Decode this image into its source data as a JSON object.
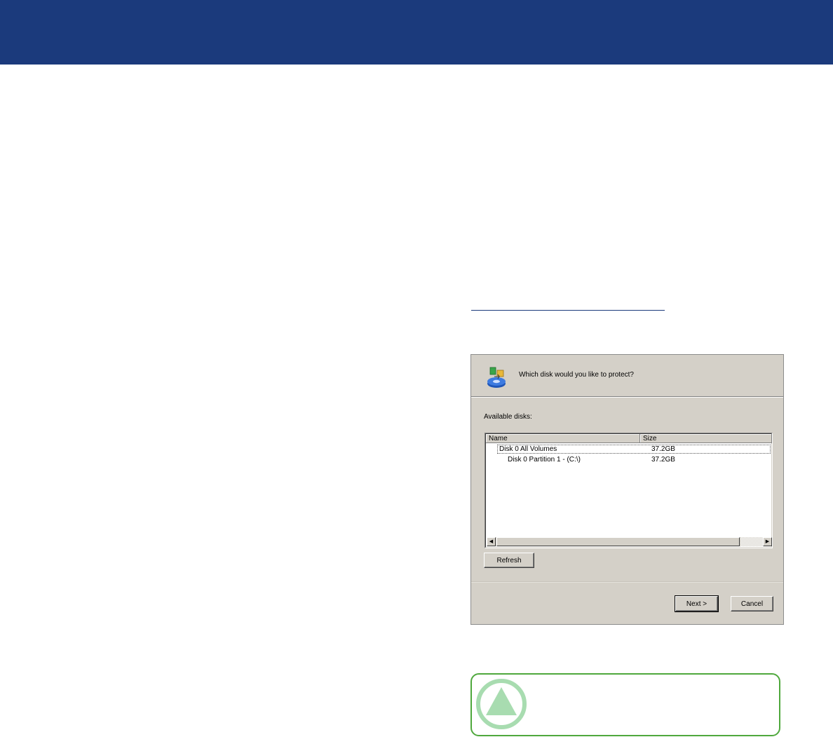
{
  "dialog": {
    "question": "Which disk would you like to protect?",
    "available_label": "Available disks:",
    "columns": {
      "name": "Name",
      "size": "Size"
    },
    "rows": [
      {
        "name": "Disk 0 All Volumes",
        "size": "37.2GB"
      },
      {
        "name": "Disk 0 Partition 1 - (C:\\)",
        "size": "37.2GB"
      }
    ],
    "refresh_label": "Refresh",
    "next_label": "Next >",
    "cancel_label": "Cancel"
  },
  "icons": {
    "dialog_icon": "disk-protect-icon",
    "scroll_left": "scroll-left-arrow-icon",
    "scroll_right": "scroll-right-arrow-icon",
    "note_icon": "caution-triangle-icon"
  },
  "colors": {
    "top_band": "#1b3a7c",
    "dialog_bg": "#d4d0c8",
    "note_border": "#4fa83d",
    "note_icon_fill": "#a8dcb0"
  }
}
